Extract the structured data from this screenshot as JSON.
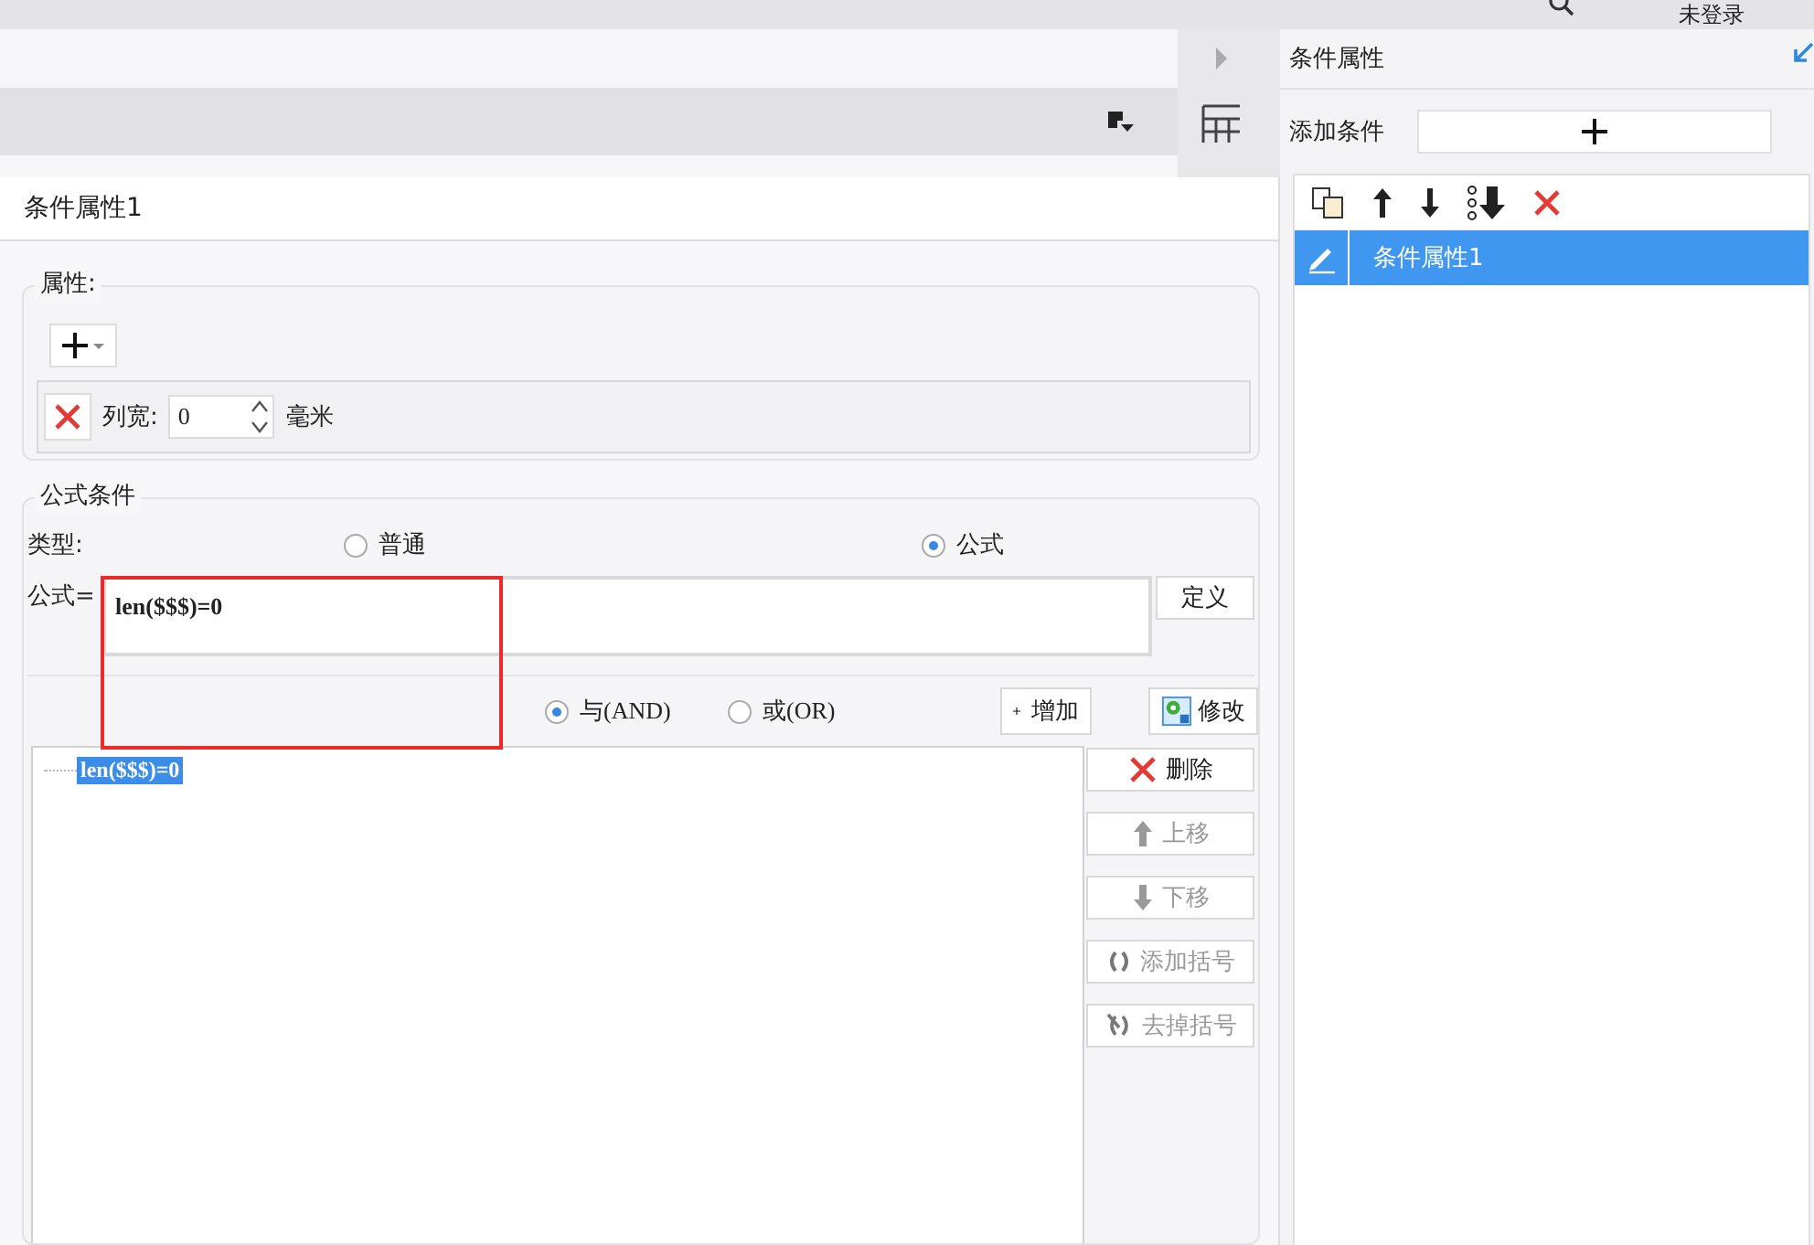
{
  "top_bar": {
    "user": "未登录"
  },
  "dialog": {
    "title": "条件属性1",
    "attributes": {
      "legend": "属性:",
      "rows": [
        {
          "label": "列宽:",
          "value": "0",
          "unit": "毫米"
        }
      ]
    },
    "formula_condition": {
      "legend": "公式条件",
      "type_label": "类型:",
      "type_options": [
        {
          "label": "普通",
          "selected": false
        },
        {
          "label": "公式",
          "selected": true
        }
      ],
      "formula_label": "公式=",
      "formula_value": "len($$$)=0",
      "define_button": "定义",
      "logic_options": [
        {
          "label": "与(AND)",
          "selected": true
        },
        {
          "label": "或(OR)",
          "selected": false
        }
      ],
      "add_button": "增加",
      "modify_button": "修改",
      "conditions": [
        {
          "text": "len($$$)=0",
          "selected": true
        }
      ],
      "side_buttons": [
        {
          "label": "删除",
          "kind": "delete",
          "disabled": false
        },
        {
          "label": "上移",
          "kind": "up",
          "disabled": true
        },
        {
          "label": "下移",
          "kind": "down",
          "disabled": true
        },
        {
          "label": "添加括号",
          "kind": "add-parens",
          "disabled": true
        },
        {
          "label": "去掉括号",
          "kind": "remove-parens",
          "disabled": true
        }
      ]
    }
  },
  "right_panel": {
    "title": "条件属性",
    "add_label": "添加条件",
    "items": [
      {
        "label": "条件属性1",
        "selected": true
      }
    ]
  }
}
